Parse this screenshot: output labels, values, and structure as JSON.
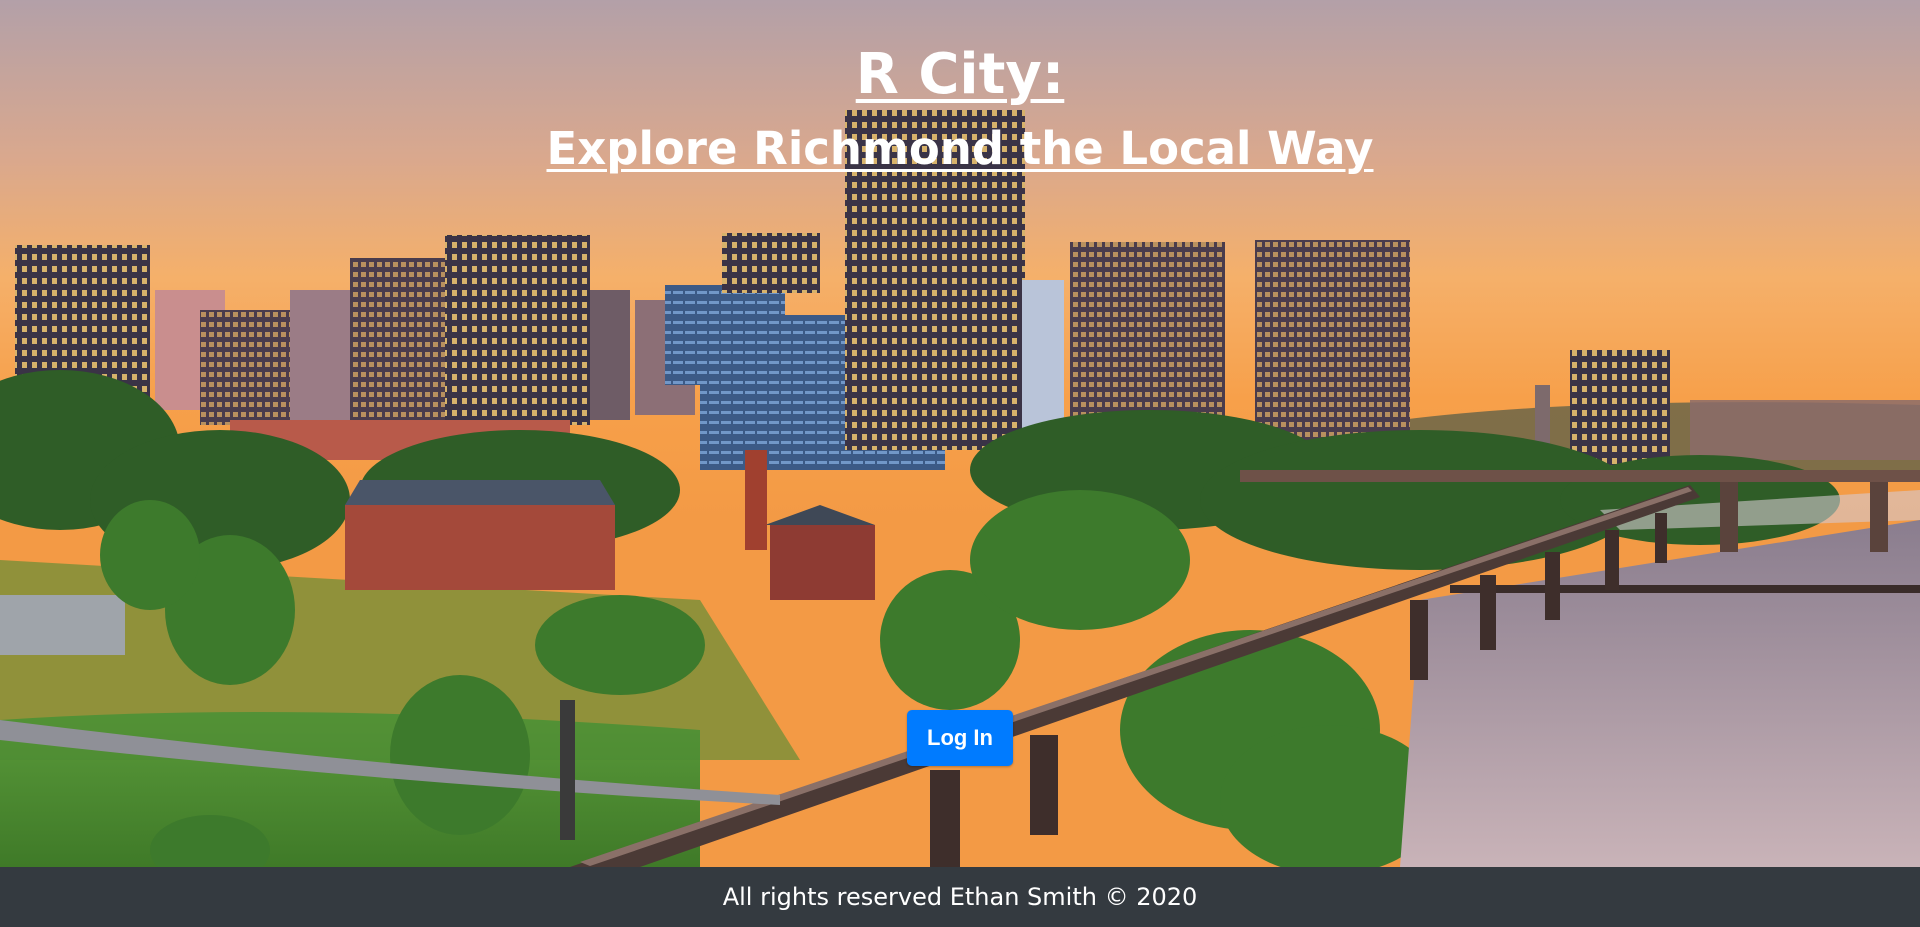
{
  "hero": {
    "title": "R City:",
    "subtitle": "Explore Richmond the Local Way",
    "image_name": "richmond-skyline-photo"
  },
  "actions": {
    "login_label": "Log In"
  },
  "footer": {
    "text": "All rights reserved Ethan Smith © 2020"
  },
  "colors": {
    "primary_button": "#007bff",
    "footer_bg": "#343a40",
    "text_light": "#ffffff"
  }
}
